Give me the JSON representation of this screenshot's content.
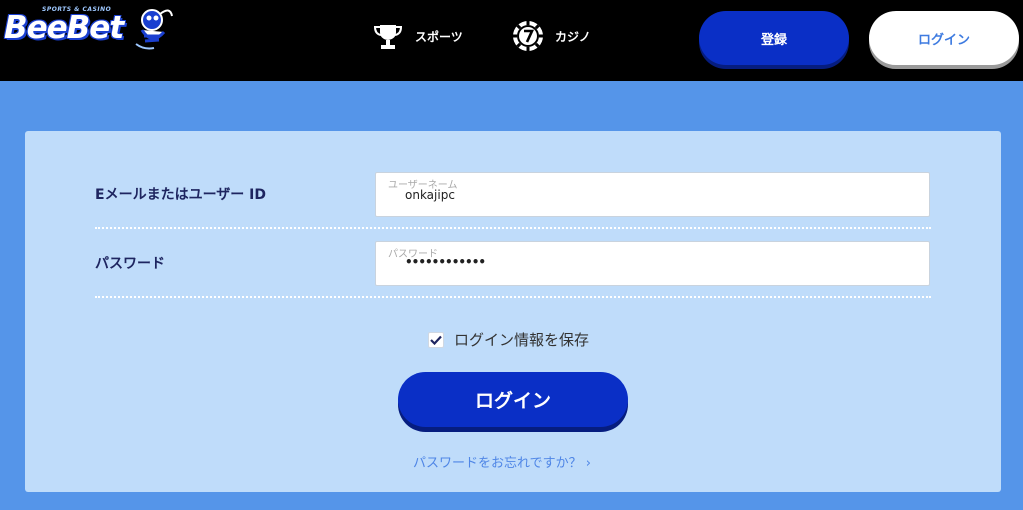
{
  "header": {
    "logo": {
      "tagline": "SPORTS & CASINO",
      "wordmark": "BeeBet"
    },
    "nav": [
      {
        "label": "スポーツ",
        "icon": "trophy-icon"
      },
      {
        "label": "カジノ",
        "icon": "casino-chip-icon"
      }
    ],
    "register_label": "登録",
    "login_label": "ログイン"
  },
  "form": {
    "email": {
      "label": "Eメールまたはユーザー ID",
      "float_label": "ユーザーネーム",
      "value": "onkajipc"
    },
    "password": {
      "label": "パスワード",
      "float_label": "パスワード",
      "value": "••••••••••••"
    },
    "remember": {
      "label": "ログイン情報を保存",
      "checked": true
    },
    "submit_label": "ログイン",
    "forgot_label": "パスワードをお忘れですか？ ›"
  },
  "colors": {
    "page_bg": "#5595e9",
    "panel_bg": "#bfdcfa",
    "primary_button": "#0a2fc6",
    "label_text": "#1e2560",
    "link": "#4f86e6"
  }
}
